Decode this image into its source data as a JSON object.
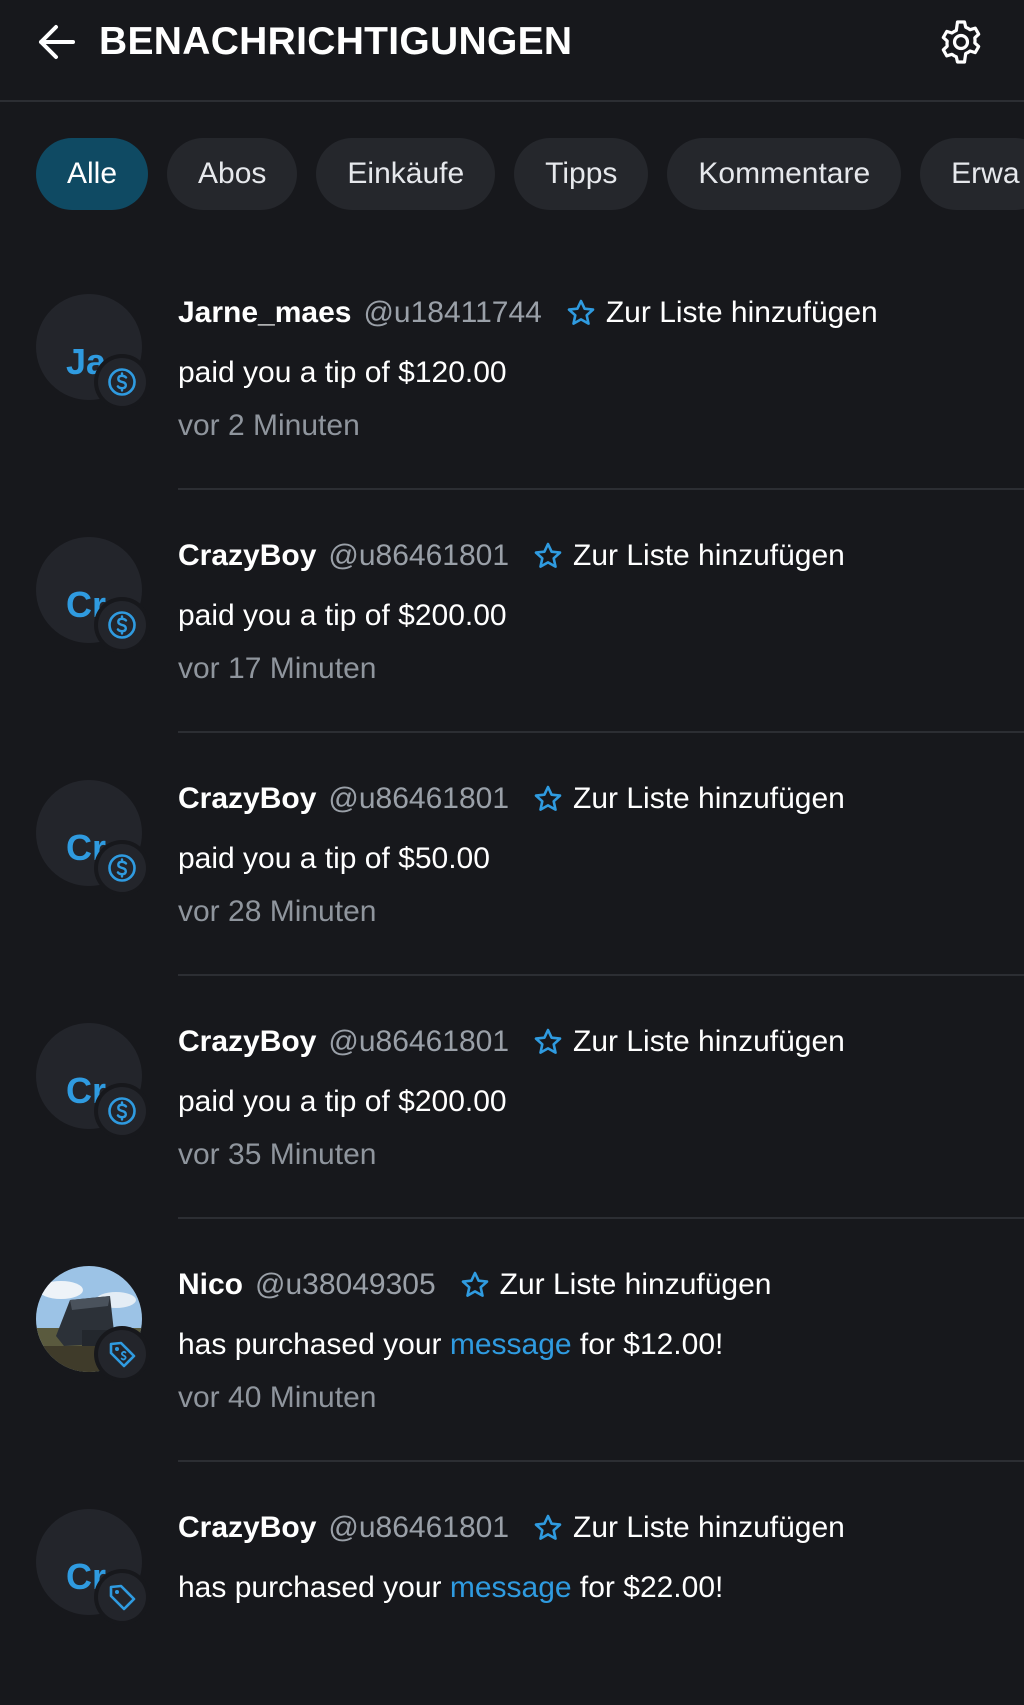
{
  "header": {
    "title": "BENACHRICHTIGUNGEN",
    "back_icon": "arrow-left-icon",
    "settings_icon": "gear-icon"
  },
  "tabs": [
    {
      "label": "Alle",
      "active": true
    },
    {
      "label": "Abos",
      "active": false
    },
    {
      "label": "Einkäufe",
      "active": false
    },
    {
      "label": "Tipps",
      "active": false
    },
    {
      "label": "Kommentare",
      "active": false
    },
    {
      "label": "Erwa",
      "active": false
    }
  ],
  "add_to_list_label": "Zur Liste hinzufügen",
  "colors": {
    "background": "#17181c",
    "accent": "#2f9be0",
    "active_tab": "#0f4a63",
    "chip": "#25272c",
    "muted_text": "#8f959d"
  },
  "notifications": [
    {
      "initials": "Ja",
      "username": "Jarne_maes",
      "handle": "@u18411744",
      "badge_icon": "dollar-circle-icon",
      "text": "paid you a tip of $120.00",
      "time": "vor 2 Minuten"
    },
    {
      "initials": "Cr",
      "username": "CrazyBoy",
      "handle": "@u86461801",
      "badge_icon": "dollar-circle-icon",
      "text": "paid you a tip of $200.00",
      "time": "vor 17 Minuten"
    },
    {
      "initials": "Cr",
      "username": "CrazyBoy",
      "handle": "@u86461801",
      "badge_icon": "dollar-circle-icon",
      "text": "paid you a tip of $50.00",
      "time": "vor 28 Minuten"
    },
    {
      "initials": "Cr",
      "username": "CrazyBoy",
      "handle": "@u86461801",
      "badge_icon": "dollar-circle-icon",
      "text": "paid you a tip of $200.00",
      "time": "vor 35 Minuten"
    },
    {
      "initials": "",
      "avatar_photo": true,
      "username": "Nico",
      "handle": "@u38049305",
      "badge_icon": "price-tag-icon",
      "text_before": "has purchased your ",
      "link_text": "message",
      "text_after": " for $12.00!",
      "time": "vor 40 Minuten"
    },
    {
      "initials": "Cr",
      "username": "CrazyBoy",
      "handle": "@u86461801",
      "badge_icon": "price-tag-icon",
      "text_before": "has purchased your ",
      "link_text": "message",
      "text_after": " for $22.00!",
      "time": ""
    }
  ]
}
